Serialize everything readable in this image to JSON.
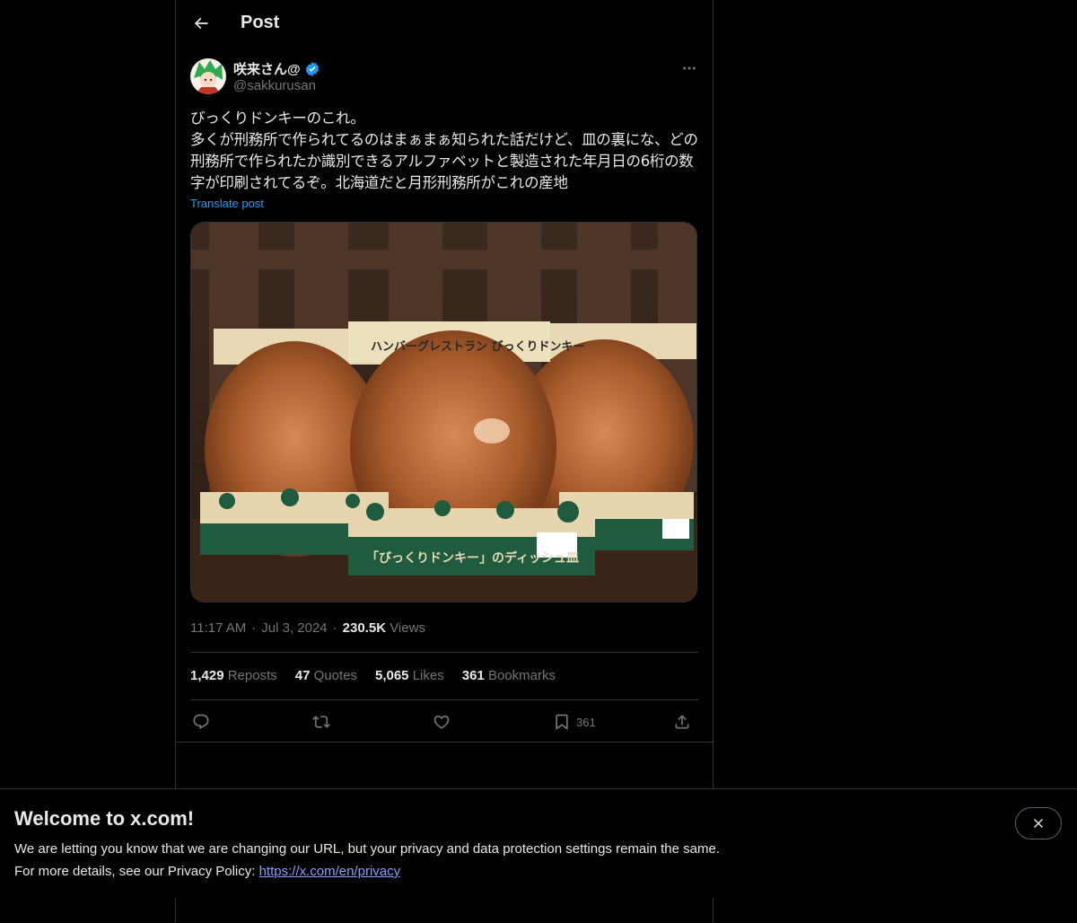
{
  "header": {
    "title": "Post"
  },
  "author": {
    "name": "咲来さん@",
    "handle": "@sakkurusan"
  },
  "post": {
    "text": "びっくりドンキーのこれ。\n多くが刑務所で作られてるのはまぁまぁ知られた話だけど、皿の裏にな、どの刑務所で作られたか識別できるアルファベットと製造された年月日の6桁の数字が印刷されてるぞ。北海道だと月形刑務所がこれの産地",
    "translate_label": "Translate post",
    "image_box_text": "ハンバーグレストラン びっくりドンキー",
    "image_base_text": "「びっくりドンキー」のディッシュ皿",
    "time": "11:17 AM",
    "date": "Jul 3, 2024",
    "views_count": "230.5K",
    "views_label": "Views"
  },
  "stats": [
    {
      "count": "1,429",
      "label": "Reposts"
    },
    {
      "count": "47",
      "label": "Quotes"
    },
    {
      "count": "5,065",
      "label": "Likes"
    },
    {
      "count": "361",
      "label": "Bookmarks"
    }
  ],
  "actions": {
    "bookmark_count": "361"
  },
  "icons": [
    "back-arrow-icon",
    "verified-badge-icon",
    "more-icon",
    "reply-icon",
    "repost-icon",
    "like-icon",
    "bookmark-icon",
    "share-icon",
    "close-icon"
  ],
  "banner": {
    "title": "Welcome to x.com!",
    "line1": "We are letting you know that we are changing our URL, but your privacy and data protection settings remain the same.",
    "line2_prefix": "For more details, see our Privacy Policy: ",
    "link": "https://x.com/en/privacy"
  },
  "colors": {
    "background": "#000000",
    "accent": "#1d9bf0",
    "text": "#e7e9ea",
    "muted": "#71767b",
    "border": "#2f3336"
  }
}
